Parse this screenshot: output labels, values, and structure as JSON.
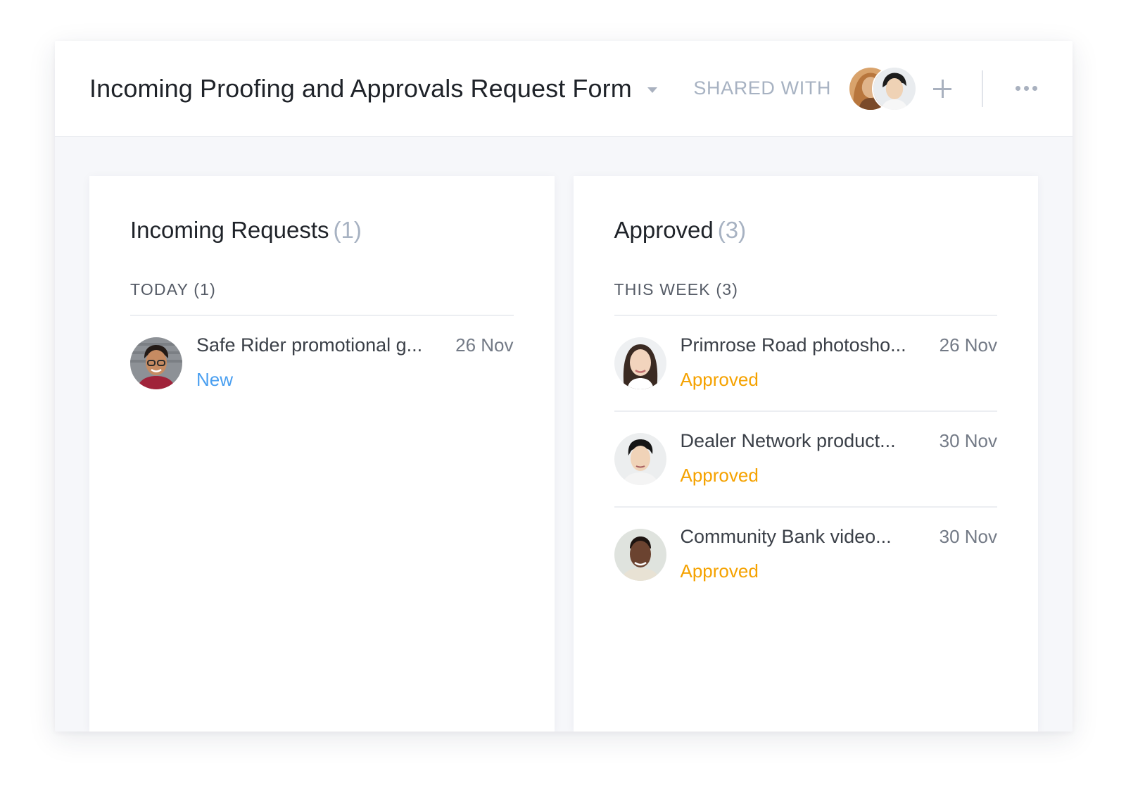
{
  "header": {
    "title": "Incoming Proofing and Approvals Request Form",
    "shared_with_label": "SHARED WITH",
    "shared_avatars": [
      "woman-portrait",
      "man-portrait"
    ]
  },
  "columns": [
    {
      "title": "Incoming Requests",
      "count": "(1)",
      "groups": [
        {
          "label": "TODAY (1)",
          "items": [
            {
              "title": "Safe Rider promotional g...",
              "date": "26 Nov",
              "status": "New"
            }
          ]
        }
      ]
    },
    {
      "title": "Approved",
      "count": "(3)",
      "groups": [
        {
          "label": "THIS WEEK (3)",
          "items": [
            {
              "title": "Primrose Road photosho...",
              "date": "26 Nov",
              "status": "Approved"
            },
            {
              "title": "Dealer Network product...",
              "date": "30 Nov",
              "status": "Approved"
            },
            {
              "title": "Community Bank video...",
              "date": "30 Nov",
              "status": "Approved"
            }
          ]
        }
      ]
    }
  ],
  "colors": {
    "status_new": "#4a9ff0",
    "status_approved": "#f5a200",
    "muted": "#a7b2c2"
  }
}
